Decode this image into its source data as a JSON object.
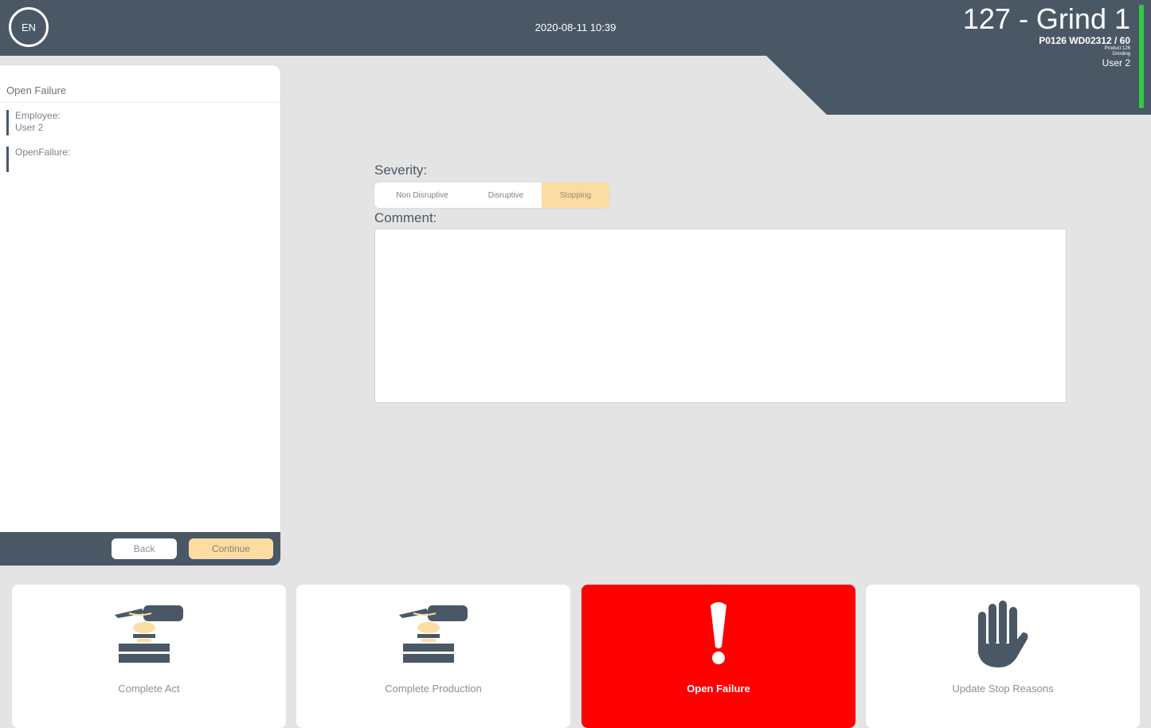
{
  "header": {
    "language": "EN",
    "datetime": "2020-08-11 10:39",
    "machine_title": "127 - Grind 1",
    "order": "P0126 WD02312 / 60",
    "product": "Product 126",
    "operation": "Grinding",
    "user": "User 2",
    "status_color": "#2ecc40"
  },
  "left_panel": {
    "title": "Open Failure",
    "steps": [
      {
        "label": "Employee:",
        "value": "User 2"
      },
      {
        "label": "OpenFailure:",
        "value": ""
      }
    ],
    "back_label": "Back",
    "continue_label": "Continue"
  },
  "form": {
    "severity_label": "Severity:",
    "severity_options": [
      "Non Disruptive",
      "Disruptive",
      "Stopping"
    ],
    "severity_selected": "Stopping",
    "comment_label": "Comment:",
    "comment_value": ""
  },
  "actions": [
    {
      "label": "Complete Act",
      "icon": "stamp-icon"
    },
    {
      "label": "Complete Production",
      "icon": "stamp-icon"
    },
    {
      "label": "Open Failure",
      "icon": "exclamation-icon",
      "active": true,
      "color": "#ff0000"
    },
    {
      "label": "Update Stop Reasons",
      "icon": "hand-stop-icon"
    }
  ],
  "colors": {
    "header": "#4a5866",
    "accent": "#fcdca2",
    "alert": "#ff0000"
  }
}
